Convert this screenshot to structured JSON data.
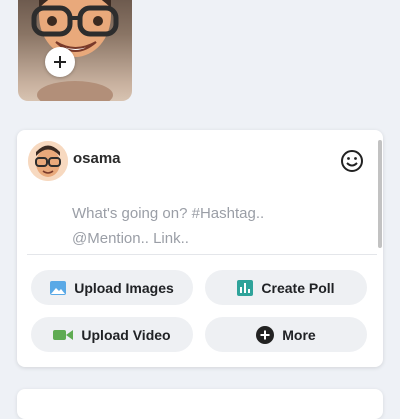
{
  "story": {
    "add_icon": "plus-icon"
  },
  "composer": {
    "username": "osama",
    "placeholder": "What's going on? #Hashtag.. @Mention.. Link..",
    "emoji_icon": "smiley-icon"
  },
  "actions": {
    "upload_images": "Upload Images",
    "create_poll": "Create Poll",
    "upload_video": "Upload Video",
    "more": "More"
  },
  "colors": {
    "images_icon": "#5aa9e6",
    "poll_icon": "#2fa39a",
    "video_icon": "#5fab52",
    "more_icon": "#222222"
  }
}
